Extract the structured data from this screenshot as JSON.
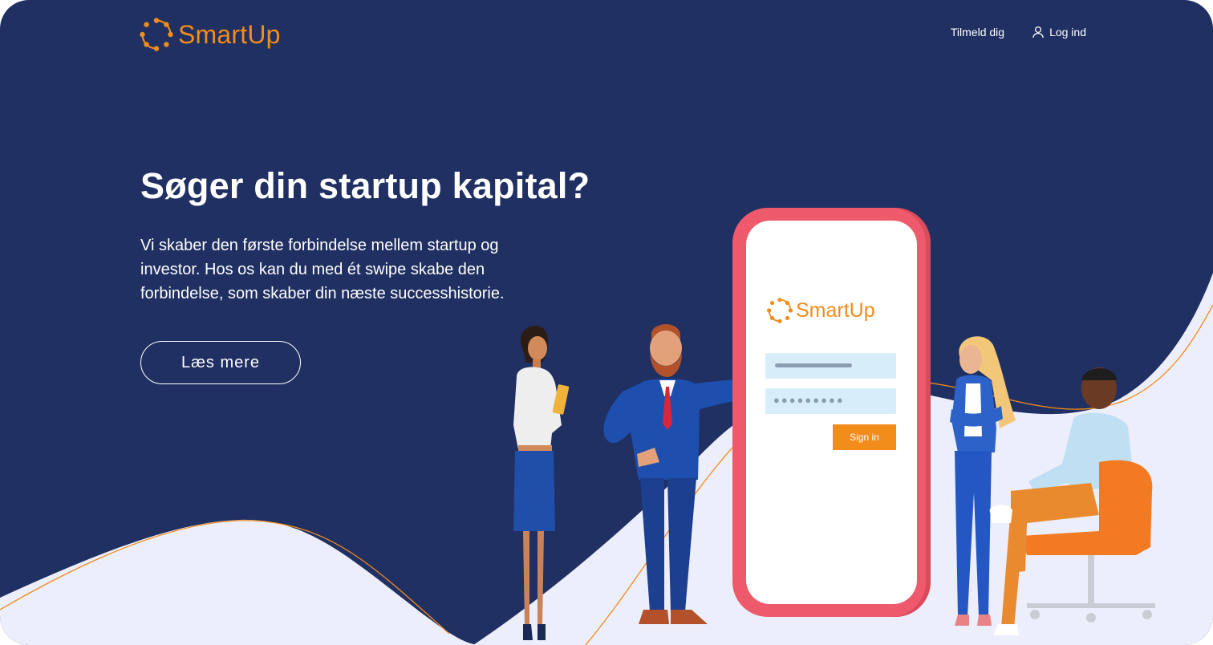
{
  "brand": {
    "name": "SmartUp",
    "color": "#f28c1a"
  },
  "nav": {
    "signup": "Tilmeld dig",
    "login": "Log ind",
    "login_icon": "user-icon"
  },
  "hero": {
    "title": "Søger din startup kapital?",
    "text": "Vi skaber den første forbindelse mellem startup og investor. Hos os kan du med ét swipe skabe den forbindelse, som skaber din næste successhistorie.",
    "cta": "Læs mere"
  },
  "phone": {
    "brand": "SmartUp",
    "password_mask": "●●●●●●●●●",
    "signin": "Sign in"
  },
  "colors": {
    "background": "#203062",
    "wave": "#eceefc",
    "accent_line": "#f28c1a",
    "phone": "#ee5a6c"
  }
}
